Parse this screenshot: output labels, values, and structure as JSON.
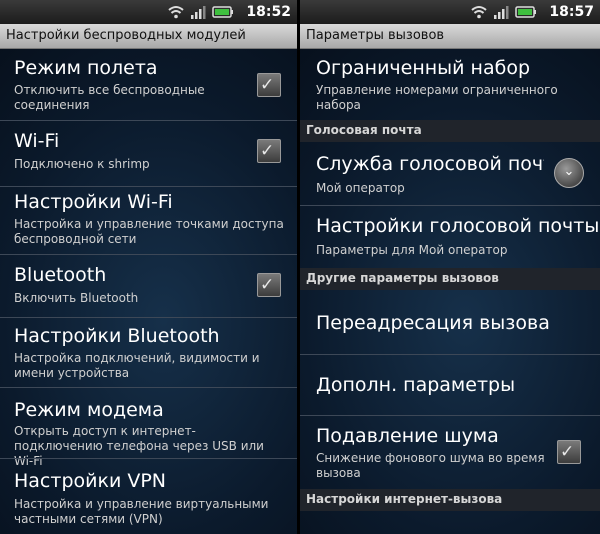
{
  "left": {
    "status": {
      "time": "18:52"
    },
    "title": "Настройки беспроводных модулей",
    "items": [
      {
        "title": "Режим полета",
        "summary": "Отключить все беспроводные соединения",
        "checked": true
      },
      {
        "title": "Wi-Fi",
        "summary": "Подключено к shrimp",
        "checked": true
      },
      {
        "title": "Настройки Wi-Fi",
        "summary": "Настройка и управление точками доступа беспроводной сети"
      },
      {
        "title": "Bluetooth",
        "summary": "Включить Bluetooth",
        "checked": true
      },
      {
        "title": "Настройки Bluetooth",
        "summary": "Настройка подключений, видимости и имени устройства"
      },
      {
        "title": "Режим модема",
        "summary": "Открыть доступ к интернет-подключению телефона через USB или Wi-Fi"
      },
      {
        "title": "Настройки VPN",
        "summary": "Настройка и управление виртуальными частными сетями (VPN)"
      }
    ]
  },
  "right": {
    "status": {
      "time": "18:57"
    },
    "title": "Параметры вызовов",
    "items": [
      {
        "title": "Ограниченный набор",
        "summary": "Управление номерами ограниченного набора"
      },
      {
        "section": "Голосовая почта"
      },
      {
        "title": "Служба голосовой почты",
        "summary": "Мой оператор",
        "spinner": true
      },
      {
        "title": "Настройки голосовой почты",
        "summary": "Параметры для Мой оператор"
      },
      {
        "section": "Другие параметры вызовов"
      },
      {
        "title": "Переадресация вызова"
      },
      {
        "title": "Дополн. параметры"
      },
      {
        "title": "Подавление шума",
        "summary": "Снижение фонового шума во время вызова",
        "checked": true
      },
      {
        "section": "Настройки интернет-вызова"
      }
    ]
  },
  "icons": {
    "status": [
      "wifi-icon",
      "signal-icon",
      "battery-icon"
    ],
    "check": "✓",
    "chevron": "⌄"
  },
  "colors": {
    "background": "#0b1a2c",
    "title_bar": "#c8c8c8",
    "section_header": "#20242b",
    "battery": "#3fbf3f"
  }
}
